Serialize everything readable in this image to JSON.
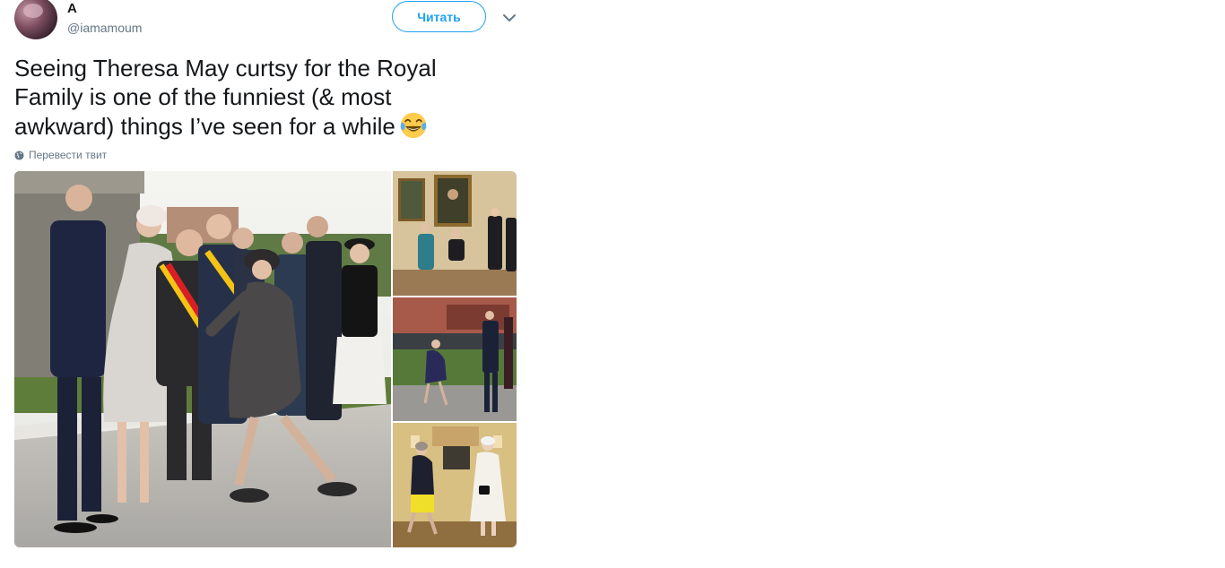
{
  "user": {
    "display_name": "A",
    "handle": "@iamamoum"
  },
  "follow_button": {
    "label": "Читать"
  },
  "tweet": {
    "lines": [
      "Seeing Theresa May curtsy for the Royal",
      "Family is one of the funniest (& most",
      "awkward) things I’ve seen for a while"
    ],
    "emoji": "face-with-tears-of-joy"
  },
  "translate": {
    "label": "Перевести твит",
    "icon": "globe-icon"
  },
  "colors": {
    "accent": "#1da1f2",
    "secondary_text": "#657786",
    "primary_text": "#14171a"
  },
  "media": {
    "count": 4
  }
}
